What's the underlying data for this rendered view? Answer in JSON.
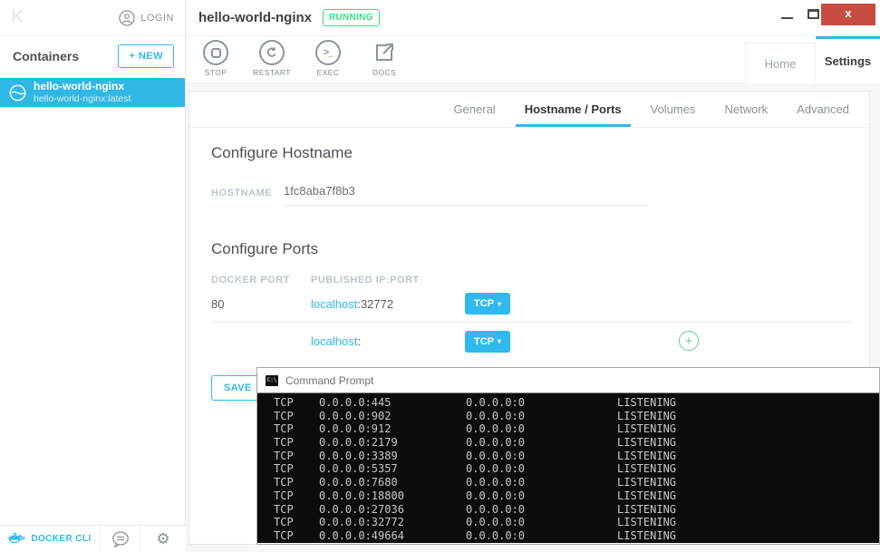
{
  "colors": {
    "accent": "#2fb9ec",
    "running_green": "#41d981",
    "close_red": "#c94c43",
    "terminal_bg": "#0c0c0c",
    "terminal_text": "#c8c8c8"
  },
  "icons": {
    "gear": "⚙",
    "exec_glyph": ">_",
    "plus": "+",
    "dropdown_caret": "▾",
    "cmd_label": "C:\\"
  },
  "titlebar": {
    "title": "hello-world-nginx",
    "status_badge": "RUNNING",
    "close_glyph": "x"
  },
  "sidebar": {
    "logo_glyph": "K",
    "login_label": "LOGIN",
    "containers_header": "Containers",
    "new_button_label": "+ NEW",
    "container": {
      "name": "hello-world-nginx",
      "image": "hello-world-nginx:latest"
    },
    "footer": {
      "docker_cli_label": "DOCKER CLI"
    }
  },
  "toolbar": {
    "stop": "STOP",
    "restart": "RESTART",
    "exec": "EXEC",
    "docs": "DOCS"
  },
  "tabs": {
    "home": "Home",
    "settings": "Settings"
  },
  "subtabs": {
    "general": "General",
    "hostname_ports": "Hostname / Ports",
    "volumes": "Volumes",
    "network": "Network",
    "advanced": "Advanced"
  },
  "hostname_section": {
    "heading": "Configure Hostname",
    "label": "HOSTNAME",
    "value": "1fc8aba7f8b3"
  },
  "ports_section": {
    "heading": "Configure Ports",
    "col_docker_port": "DOCKER PORT",
    "col_published": "PUBLISHED IP:PORT",
    "rows": [
      {
        "docker_port": "80",
        "host": "localhost",
        "separator": ":",
        "port": "32772",
        "protocol": "TCP"
      },
      {
        "docker_port": "",
        "host": "localhost",
        "separator": ":",
        "port": "",
        "protocol": "TCP"
      }
    ],
    "save_label": "SAVE"
  },
  "terminal": {
    "window_title": "Command Prompt",
    "rows": [
      {
        "proto": "TCP",
        "local": "0.0.0.0:445",
        "foreign": "0.0.0.0:0",
        "state": "LISTENING"
      },
      {
        "proto": "TCP",
        "local": "0.0.0.0:902",
        "foreign": "0.0.0.0:0",
        "state": "LISTENING"
      },
      {
        "proto": "TCP",
        "local": "0.0.0.0:912",
        "foreign": "0.0.0.0:0",
        "state": "LISTENING"
      },
      {
        "proto": "TCP",
        "local": "0.0.0.0:2179",
        "foreign": "0.0.0.0:0",
        "state": "LISTENING"
      },
      {
        "proto": "TCP",
        "local": "0.0.0.0:3389",
        "foreign": "0.0.0.0:0",
        "state": "LISTENING"
      },
      {
        "proto": "TCP",
        "local": "0.0.0.0:5357",
        "foreign": "0.0.0.0:0",
        "state": "LISTENING"
      },
      {
        "proto": "TCP",
        "local": "0.0.0.0:7680",
        "foreign": "0.0.0.0:0",
        "state": "LISTENING"
      },
      {
        "proto": "TCP",
        "local": "0.0.0.0:18800",
        "foreign": "0.0.0.0:0",
        "state": "LISTENING"
      },
      {
        "proto": "TCP",
        "local": "0.0.0.0:27036",
        "foreign": "0.0.0.0:0",
        "state": "LISTENING"
      },
      {
        "proto": "TCP",
        "local": "0.0.0.0:32772",
        "foreign": "0.0.0.0:0",
        "state": "LISTENING"
      },
      {
        "proto": "TCP",
        "local": "0.0.0.0:49664",
        "foreign": "0.0.0.0:0",
        "state": "LISTENING"
      }
    ]
  }
}
